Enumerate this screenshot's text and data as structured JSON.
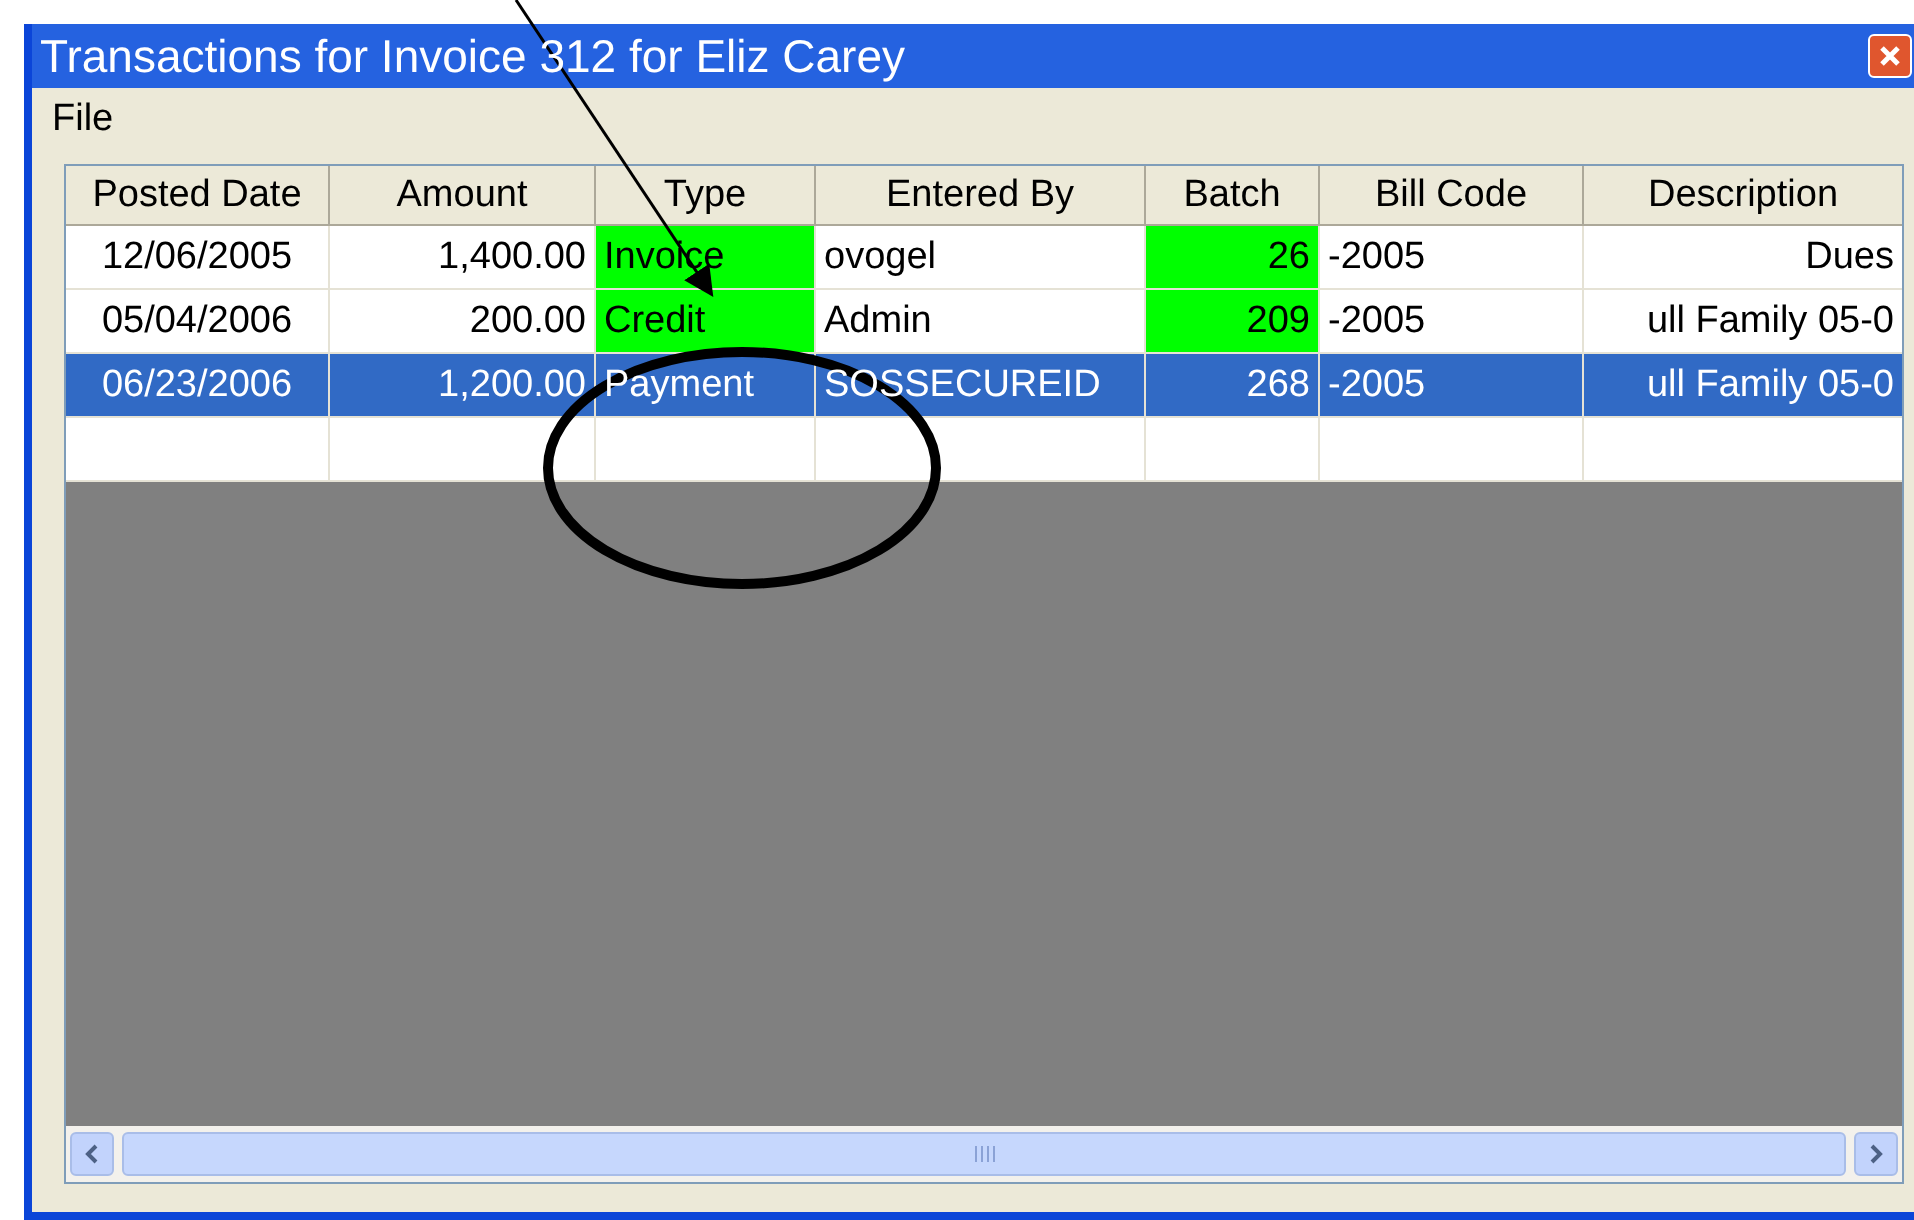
{
  "window": {
    "title": "Transactions for Invoice 312 for Eliz Carey"
  },
  "menu": [
    "File"
  ],
  "table": {
    "columns": [
      "Posted Date",
      "Amount",
      "Type",
      "Entered By",
      "Batch",
      "Bill Code",
      "Description"
    ],
    "rows": [
      {
        "selected": false,
        "cells": [
          {
            "text": "12/06/2005",
            "highlighted": false
          },
          {
            "text": "1,400.00",
            "highlighted": false
          },
          {
            "text": "Invoice",
            "highlighted": true
          },
          {
            "text": "ovogel",
            "highlighted": false
          },
          {
            "text": "26",
            "highlighted": true
          },
          {
            "text": "-2005",
            "highlighted": false
          },
          {
            "text": "Dues",
            "highlighted": false
          }
        ]
      },
      {
        "selected": false,
        "cells": [
          {
            "text": "05/04/2006",
            "highlighted": false
          },
          {
            "text": "200.00",
            "highlighted": false
          },
          {
            "text": "Credit",
            "highlighted": true
          },
          {
            "text": "Admin",
            "highlighted": false
          },
          {
            "text": "209",
            "highlighted": true
          },
          {
            "text": "-2005",
            "highlighted": false
          },
          {
            "text": "ull Family 05-0",
            "highlighted": false
          }
        ]
      },
      {
        "selected": true,
        "cells": [
          {
            "text": "06/23/2006",
            "highlighted": false
          },
          {
            "text": "1,200.00",
            "highlighted": false
          },
          {
            "text": "Payment",
            "highlighted": false
          },
          {
            "text": "SOSSECUREID",
            "highlighted": false
          },
          {
            "text": "268",
            "highlighted": false
          },
          {
            "text": "-2005",
            "highlighted": false
          },
          {
            "text": "ull Family 05-0",
            "highlighted": false
          }
        ]
      }
    ]
  }
}
